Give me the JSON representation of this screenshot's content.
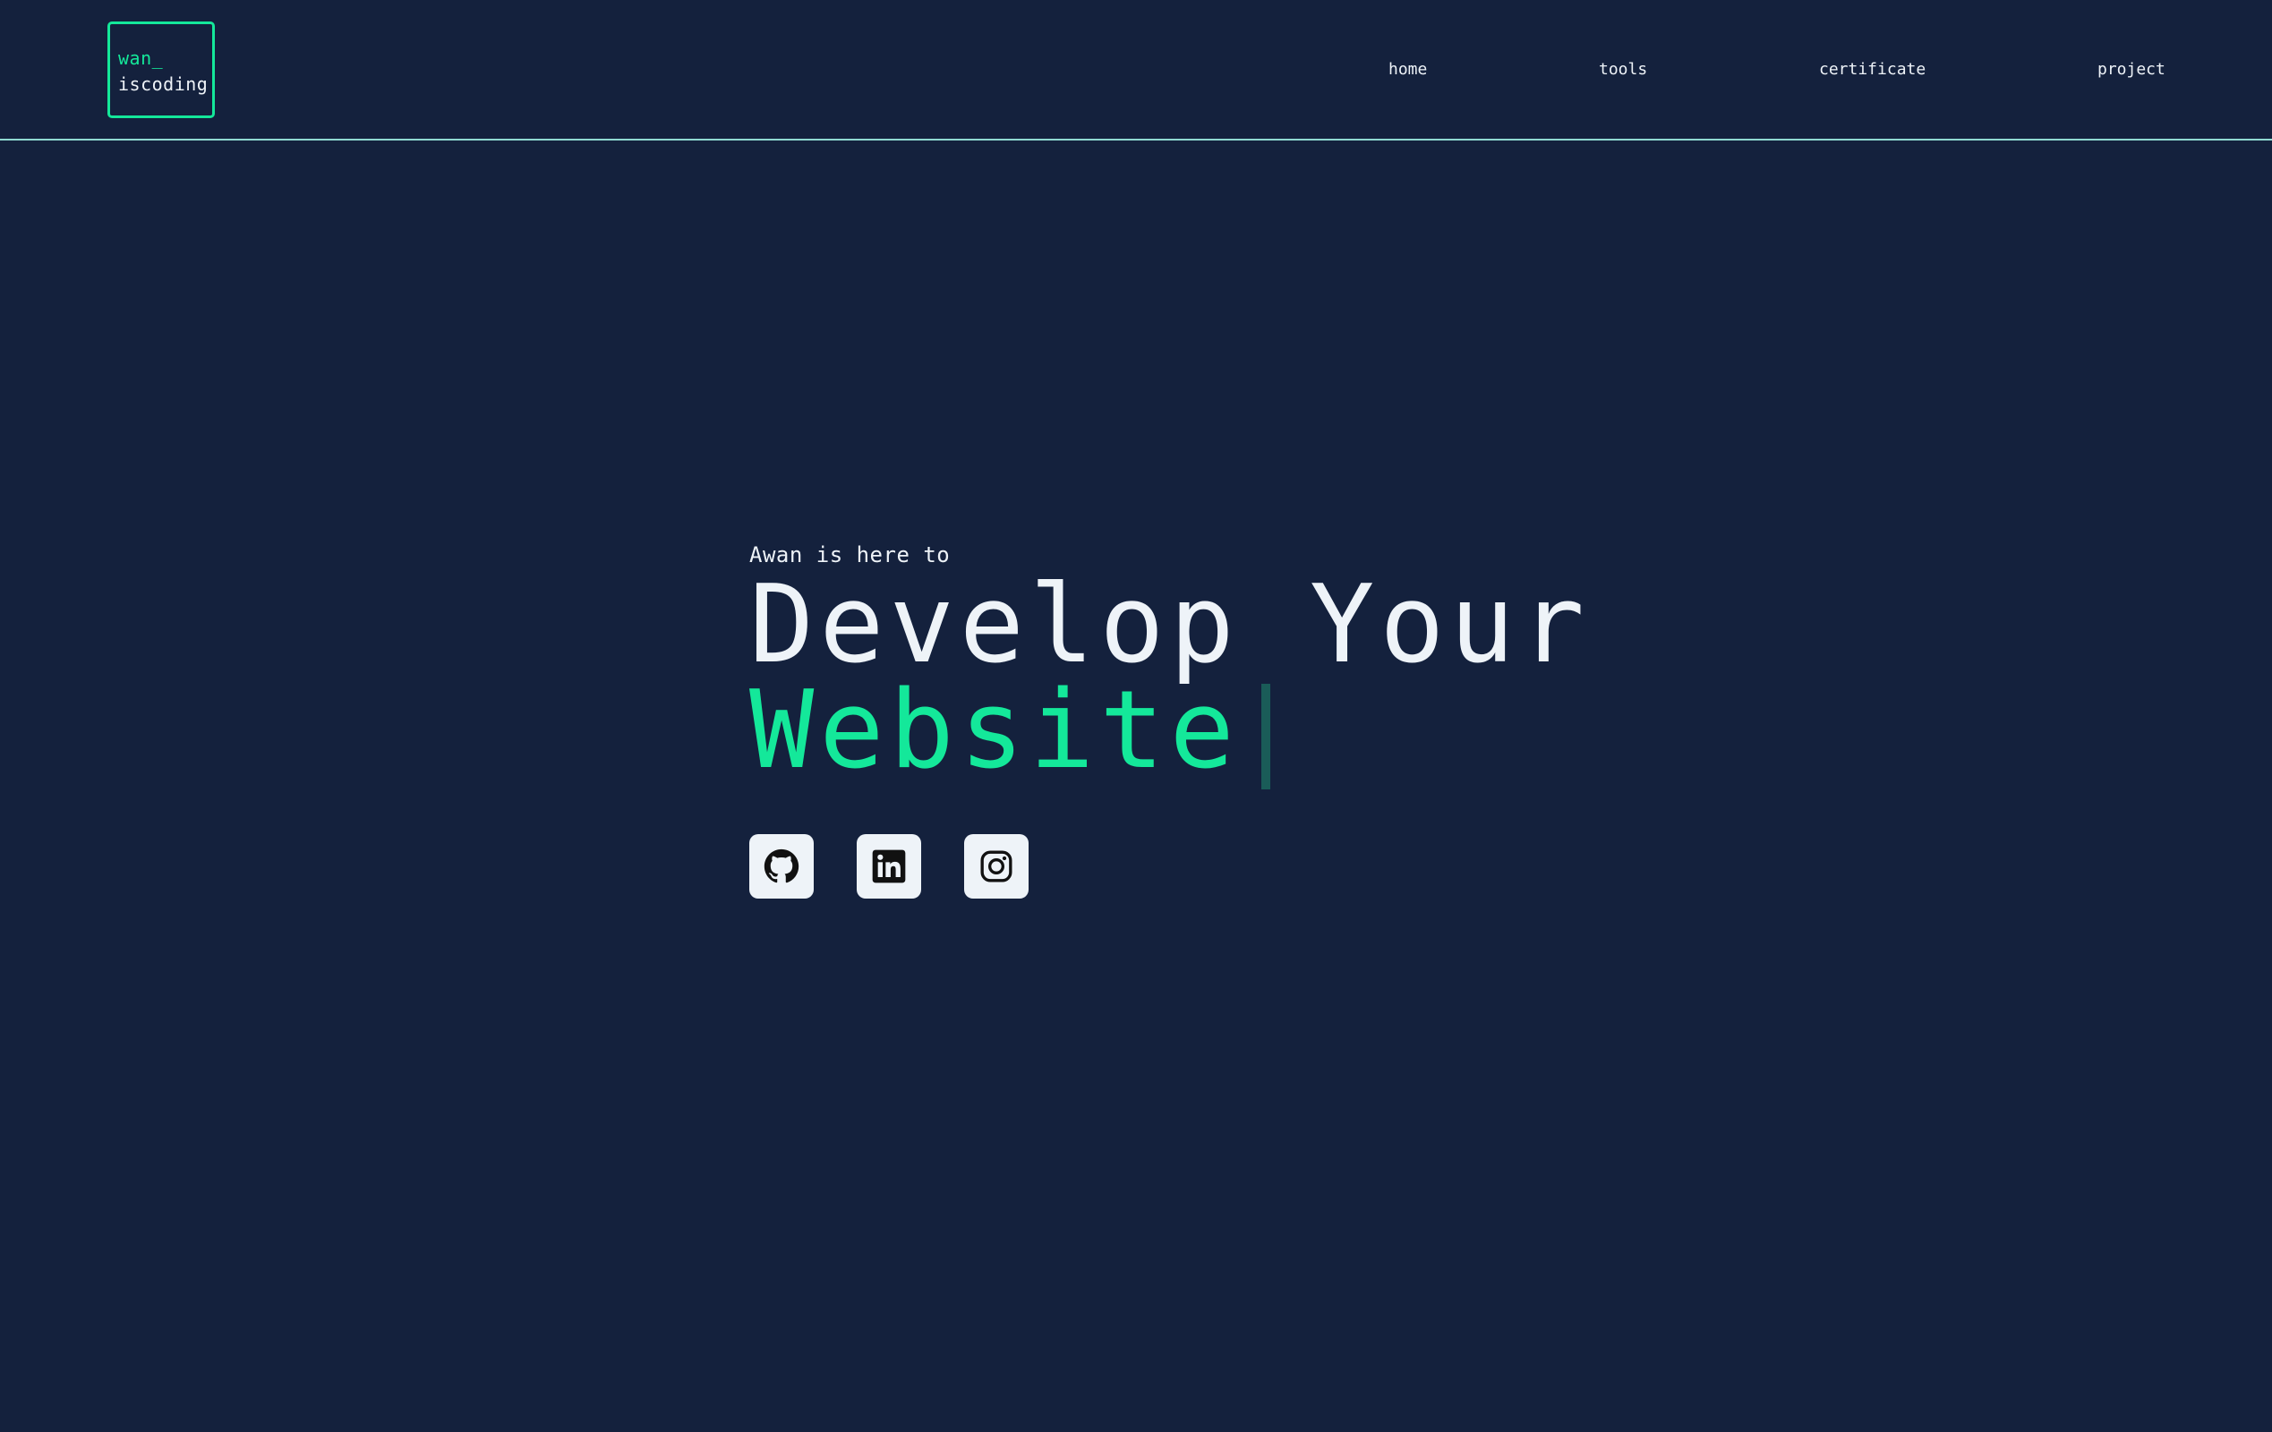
{
  "logo": {
    "line1": "wan_",
    "line2": "iscoding"
  },
  "nav": {
    "items": [
      {
        "label": "home"
      },
      {
        "label": "tools"
      },
      {
        "label": "certificate"
      },
      {
        "label": "project"
      }
    ]
  },
  "hero": {
    "subtitle": "Awan is here to",
    "title_line1": "Develop Your",
    "title_line2": "Website"
  },
  "socials": [
    {
      "icon": "github-icon"
    },
    {
      "icon": "linkedin-icon"
    },
    {
      "icon": "instagram-icon"
    }
  ],
  "colors": {
    "background": "#14213d",
    "accent": "#14e89a",
    "text": "#eef3f8",
    "divider": "#8fd9d0",
    "cursor": "#1a5c58"
  }
}
